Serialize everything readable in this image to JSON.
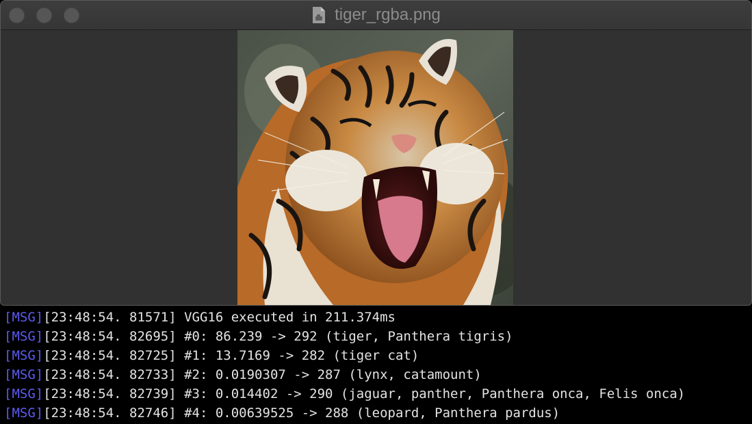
{
  "window": {
    "title": "tiger_rgba.png",
    "buttons": [
      "close",
      "minimize",
      "zoom"
    ],
    "file_icon": "document-icon"
  },
  "image": {
    "description_icon": "tiger-image"
  },
  "console": {
    "tag_color": "#5b5bf0",
    "text_color": "#e4e4e4",
    "lines": [
      {
        "tag": "[MSG]",
        "timestamp": "[23:48:54. 81571]",
        "message": " VGG16 executed in 211.374ms"
      },
      {
        "tag": "[MSG]",
        "timestamp": "[23:48:54. 82695]",
        "message": " #0: 86.239 -> 292 (tiger, Panthera tigris)"
      },
      {
        "tag": "[MSG]",
        "timestamp": "[23:48:54. 82725]",
        "message": " #1: 13.7169 -> 282 (tiger cat)"
      },
      {
        "tag": "[MSG]",
        "timestamp": "[23:48:54. 82733]",
        "message": " #2: 0.0190307 -> 287 (lynx, catamount)"
      },
      {
        "tag": "[MSG]",
        "timestamp": "[23:48:54. 82739]",
        "message": " #3: 0.014402 -> 290 (jaguar, panther, Panthera onca, Felis onca)"
      },
      {
        "tag": "[MSG]",
        "timestamp": "[23:48:54. 82746]",
        "message": " #4: 0.00639525 -> 288 (leopard, Panthera pardus)"
      }
    ]
  }
}
